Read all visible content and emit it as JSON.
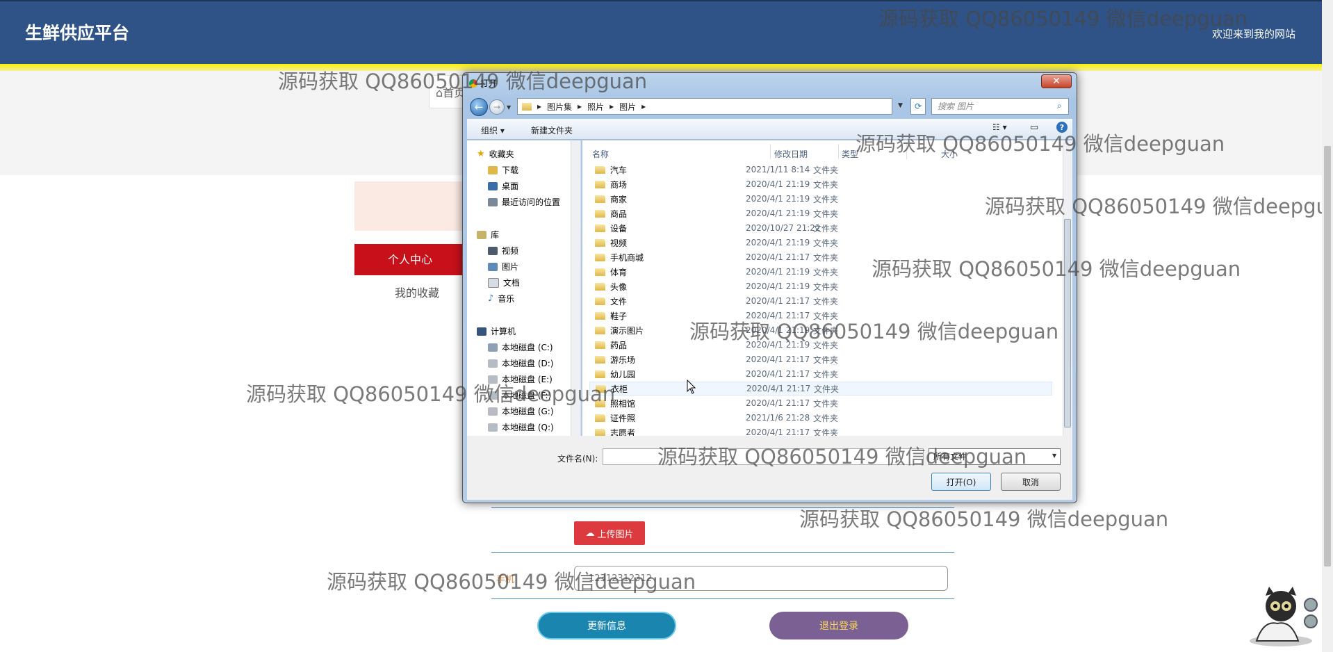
{
  "header": {
    "brand": "生鲜供应平台",
    "welcome": "欢迎来到我的网站",
    "nav_home": "⌂首页"
  },
  "sidebar": {
    "active": "个人中心",
    "favorites": "我的收藏"
  },
  "form": {
    "upload_label": "上传图片",
    "phone_label": "手机",
    "phone_value": "12312312312",
    "update_label": "更新信息",
    "logout_label": "退出登录"
  },
  "dialog": {
    "title": "打开",
    "close": "✕",
    "breadcrumb": [
      "图片集",
      "照片",
      "图片"
    ],
    "search_placeholder": "搜索 图片",
    "toolbar": {
      "organize": "组织 ▾",
      "new_folder": "新建文件夹"
    },
    "nav": {
      "favorites": "收藏夹",
      "downloads": "下载",
      "desktop": "桌面",
      "recent": "最近访问的位置",
      "libraries": "库",
      "videos": "视频",
      "pictures": "图片",
      "documents": "文档",
      "music": "音乐",
      "computer": "计算机",
      "drives": [
        "本地磁盘 (C:)",
        "本地磁盘 (D:)",
        "本地磁盘 (E:)",
        "本地磁盘 (F:)",
        "本地磁盘 (G:)",
        "本地磁盘 (Q:)"
      ]
    },
    "columns": {
      "name": "名称",
      "date": "修改日期",
      "type": "类型",
      "size": "大小"
    },
    "rows": [
      {
        "name": "汽车",
        "date": "2021/1/11 8:14",
        "type": "文件夹"
      },
      {
        "name": "商场",
        "date": "2020/4/1 21:19",
        "type": "文件夹"
      },
      {
        "name": "商家",
        "date": "2020/4/1 21:19",
        "type": "文件夹"
      },
      {
        "name": "商品",
        "date": "2020/4/1 21:19",
        "type": "文件夹"
      },
      {
        "name": "设备",
        "date": "2020/10/27 21:22",
        "type": "文件夹"
      },
      {
        "name": "视频",
        "date": "2020/4/1 21:19",
        "type": "文件夹"
      },
      {
        "name": "手机商城",
        "date": "2020/4/1 21:17",
        "type": "文件夹"
      },
      {
        "name": "体育",
        "date": "2020/4/1 21:19",
        "type": "文件夹"
      },
      {
        "name": "头像",
        "date": "2020/4/1 21:19",
        "type": "文件夹"
      },
      {
        "name": "文件",
        "date": "2020/4/1 21:17",
        "type": "文件夹"
      },
      {
        "name": "鞋子",
        "date": "2020/4/1 21:17",
        "type": "文件夹"
      },
      {
        "name": "演示图片",
        "date": "2020/4/1 21:19",
        "type": "文件夹"
      },
      {
        "name": "药品",
        "date": "2020/4/1 21:19",
        "type": "文件夹"
      },
      {
        "name": "游乐场",
        "date": "2020/4/1 21:17",
        "type": "文件夹"
      },
      {
        "name": "幼儿园",
        "date": "2020/4/1 21:17",
        "type": "文件夹"
      },
      {
        "name": "衣柜",
        "date": "2020/4/1 21:17",
        "type": "文件夹"
      },
      {
        "name": "照相馆",
        "date": "2020/4/1 21:17",
        "type": "文件夹"
      },
      {
        "name": "证件照",
        "date": "2021/1/6 21:28",
        "type": "文件夹"
      },
      {
        "name": "志愿者",
        "date": "2020/4/1 21:17",
        "type": "文件夹"
      }
    ],
    "filename_label": "文件名(N):",
    "filter": "所有文件",
    "open": "打开(O)",
    "cancel": "取消"
  },
  "watermark": "源码获取 QQ86050149 微信deepguan"
}
